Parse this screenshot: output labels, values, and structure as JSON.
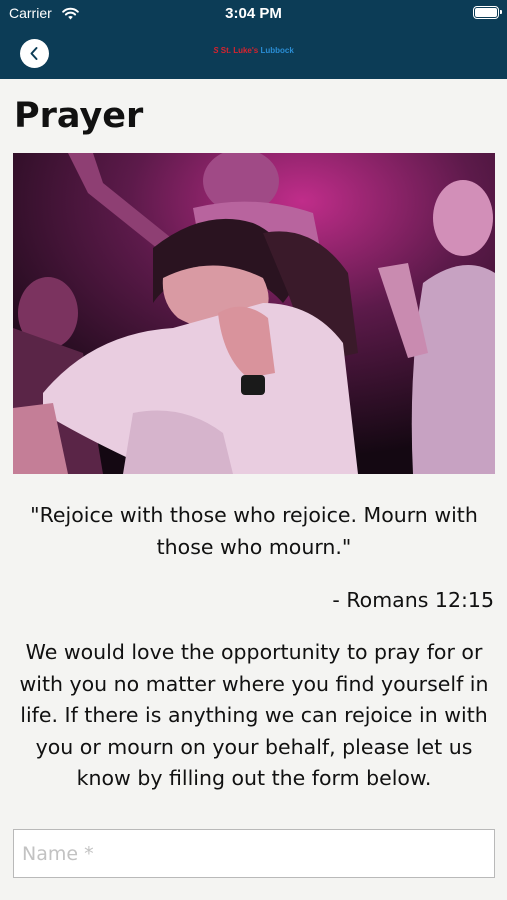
{
  "status_bar": {
    "carrier": "Carrier",
    "time": "3:04 PM",
    "wifi_icon": "wifi-icon",
    "battery_icon": "battery-icon"
  },
  "nav": {
    "back_icon": "chevron-left-icon",
    "logo": {
      "mark": "S",
      "name_part1": "St. Luke's",
      "name_part2": "Lubbock"
    }
  },
  "page": {
    "title": "Prayer",
    "image_alt_icon": "photo-prayer-hug",
    "quote": "\"Rejoice with those who rejoice. Mourn with those who mourn.\"",
    "citation": "- Romans 12:15",
    "body": "We would love the opportunity to pray for or with you no matter where you find yourself in life. If there is anything we can rejoice in with you or mourn on your behalf, please let us know by filling out the form below."
  },
  "form": {
    "name": {
      "value": "",
      "placeholder": "Name *"
    }
  },
  "colors": {
    "header_bg": "#0c3c56",
    "page_bg": "#f4f4f2",
    "logo_red": "#d7232e",
    "logo_blue": "#2a8dd4"
  }
}
